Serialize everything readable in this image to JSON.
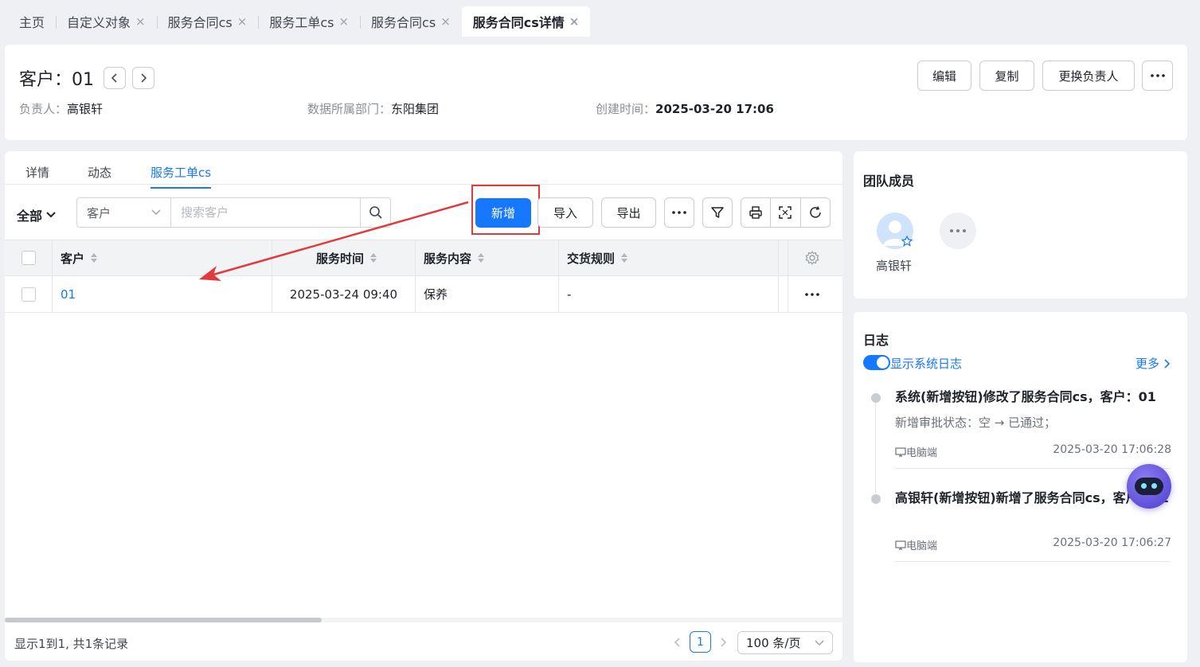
{
  "tabs": [
    {
      "label": "主页",
      "closable": false
    },
    {
      "label": "自定义对象",
      "closable": true
    },
    {
      "label": "服务合同cs",
      "closable": true
    },
    {
      "label": "服务工单cs",
      "closable": true
    },
    {
      "label": "服务合同cs",
      "closable": true
    },
    {
      "label": "服务合同cs详情",
      "closable": true,
      "active": true
    }
  ],
  "tab_close_glyph": "×",
  "record": {
    "title": "客户：01",
    "owner_label": "负责人：",
    "owner": "高银轩",
    "dept_label": "数据所属部门：",
    "dept": "东阳集团",
    "created_label": "创建时间：",
    "created": "2025-03-20 17:06"
  },
  "header_actions": {
    "edit": "编辑",
    "copy": "复制",
    "change_owner": "更换负责人"
  },
  "subtabs": [
    "详情",
    "动态",
    "服务工单cs"
  ],
  "toolbar": {
    "scope": "全部",
    "search_field": "客户",
    "search_placeholder": "搜索客户",
    "add": "新增",
    "import": "导入",
    "export": "导出"
  },
  "table": {
    "columns": [
      "客户",
      "服务时间",
      "服务内容",
      "交货规则"
    ],
    "rows": [
      {
        "customer": "01",
        "service_time": "2025-03-24 09:40",
        "service_content": "保养",
        "delivery_rule": "-"
      }
    ]
  },
  "footer": {
    "summary": "显示1到1, 共1条记录",
    "page": "1",
    "page_size": "100 条/页"
  },
  "team": {
    "title": "团队成员",
    "members": [
      "高银轩"
    ]
  },
  "log": {
    "title": "日志",
    "toggle_label": "显示系统日志",
    "more": "更多",
    "entries": [
      {
        "title": "系统(新增按钮)修改了服务合同cs，客户：01",
        "detail": "新增审批状态：空 → 已通过；",
        "source": "电脑端",
        "time": "2025-03-20 17:06:28"
      },
      {
        "title": "高银轩(新增按钮)新增了服务合同cs，客户：01",
        "source": "电脑端",
        "time": "2025-03-20 17:06:27"
      }
    ]
  },
  "colors": {
    "accent": "#1677ff",
    "highlight": "#e03b3b",
    "background": "#eef0f4"
  }
}
